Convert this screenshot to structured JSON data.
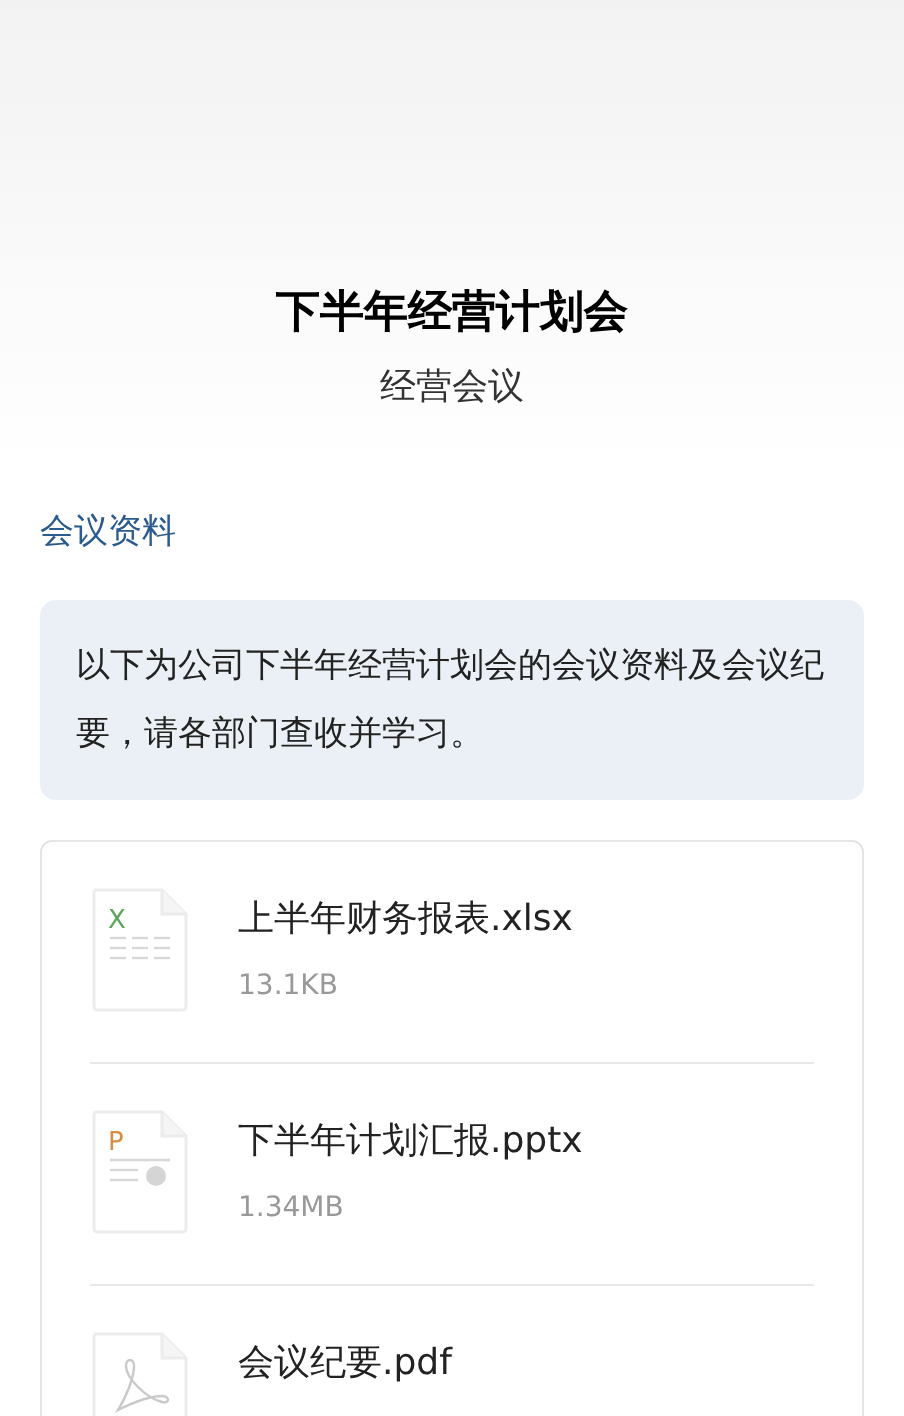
{
  "header": {
    "title": "下半年经营计划会",
    "subtitle": "经营会议"
  },
  "section_title": "会议资料",
  "notice": "以下为公司下半年经营计划会的会议资料及会议纪要，请各部门查收并学习。",
  "files": [
    {
      "kind": "xlsx",
      "badge": "X",
      "name": "上半年财务报表.xlsx",
      "size": "13.1KB"
    },
    {
      "kind": "pptx",
      "badge": "P",
      "name": "下半年计划汇报.pptx",
      "size": "1.34MB"
    },
    {
      "kind": "pdf",
      "name": "会议纪要.pdf"
    }
  ]
}
